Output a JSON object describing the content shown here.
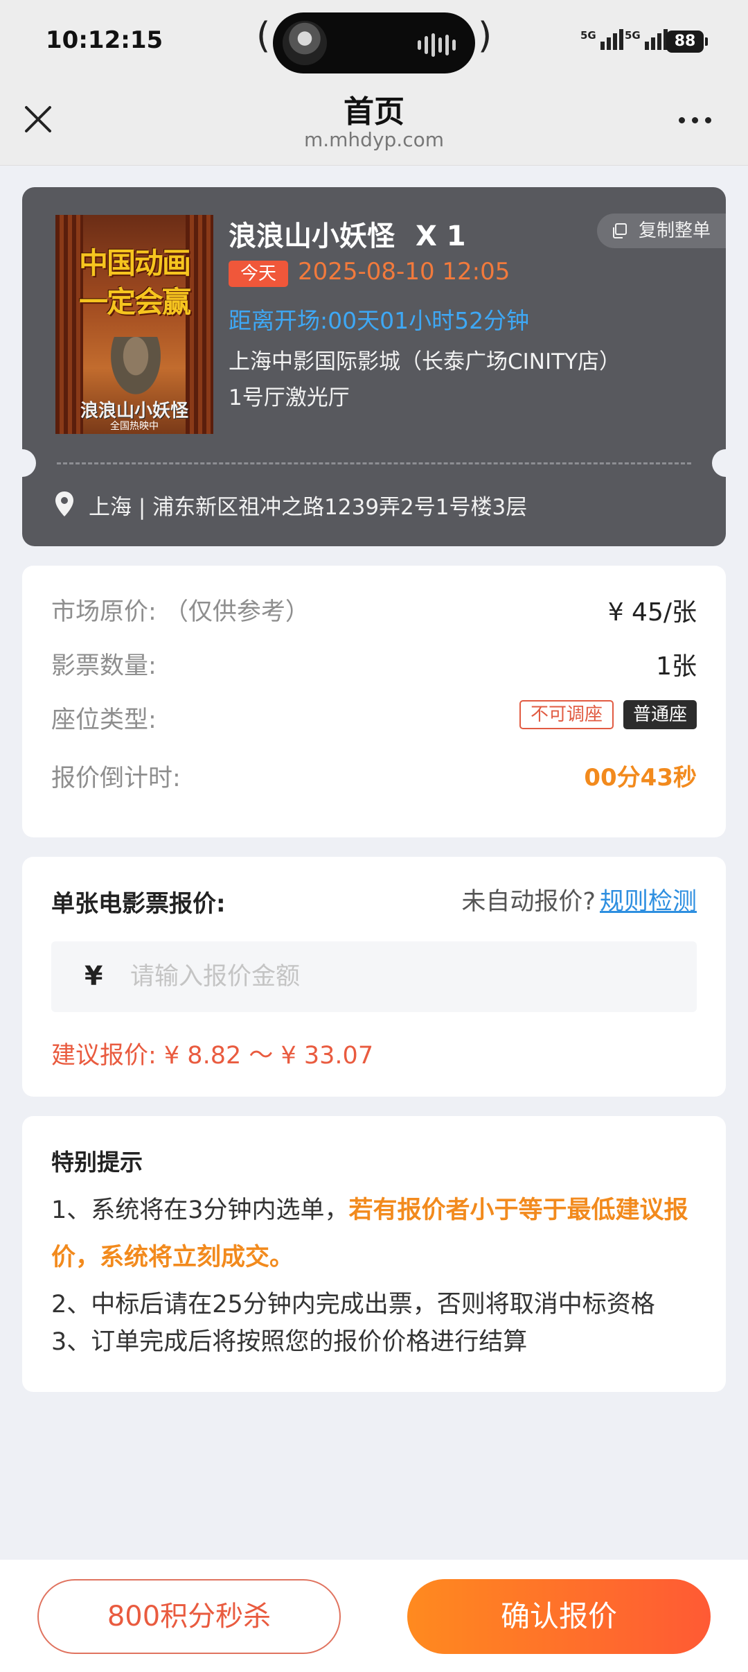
{
  "status_bar": {
    "time": "10:12:15",
    "signal_1": "5G",
    "signal_2": "5G",
    "battery": "88"
  },
  "nav": {
    "title": "首页",
    "url": "m.mhdyp.com"
  },
  "ticket": {
    "poster": {
      "headline_line1": "中国动画",
      "headline_line2": "一定会赢",
      "brand": "浪浪山小妖怪",
      "sub": "全国热映中"
    },
    "movie_title": "浪浪山小妖怪",
    "quantity": "X 1",
    "copy_button": "复制整单",
    "today_tag": "今天",
    "show_time": "2025-08-10 12:05",
    "countdown_to_start": "距离开场:00天01小时52分钟",
    "cinema": "上海中影国际影城（长泰广场CINITY店）",
    "hall": "1号厅激光厅",
    "address": "上海 | 浦东新区祖冲之路1239弄2号1号楼3层"
  },
  "info": {
    "market_price_label": "市场原价: （仅供参考）",
    "market_price_value": "¥ 45/张",
    "ticket_count_label": "影票数量:",
    "ticket_count_value": "1张",
    "seat_type_label": "座位类型:",
    "seat_tag_fixed": "不可调座",
    "seat_tag_normal": "普通座",
    "quote_countdown_label": "报价倒计时:",
    "quote_countdown_value": "00分43秒"
  },
  "quote": {
    "label": "单张电影票报价:",
    "help_text": "未自动报价?",
    "rule_link": "规则检测",
    "currency": "¥",
    "input_placeholder": "请输入报价金额",
    "input_value": "",
    "suggestion": "建议报价: ¥ 8.82 ～ ¥ 33.07"
  },
  "tips": {
    "title": "特别提示",
    "tip1_prefix": "1、系统将在3分钟内选单，",
    "tip1_emphasis": "若有报价者小于等于最低建议报价，系统将立刻成交。",
    "tip2": "2、中标后请在25分钟内完成出票，否则将取消中标资格",
    "tip3": "3、订单完成后将按照您的报价价格进行结算"
  },
  "actions": {
    "seckill_button": "800积分秒杀",
    "confirm_button": "确认报价"
  },
  "colors": {
    "accent_orange": "#f28a1d",
    "accent_red": "#e95b3f",
    "link_blue": "#2e8fe0",
    "ticket_bg": "#58595e"
  }
}
